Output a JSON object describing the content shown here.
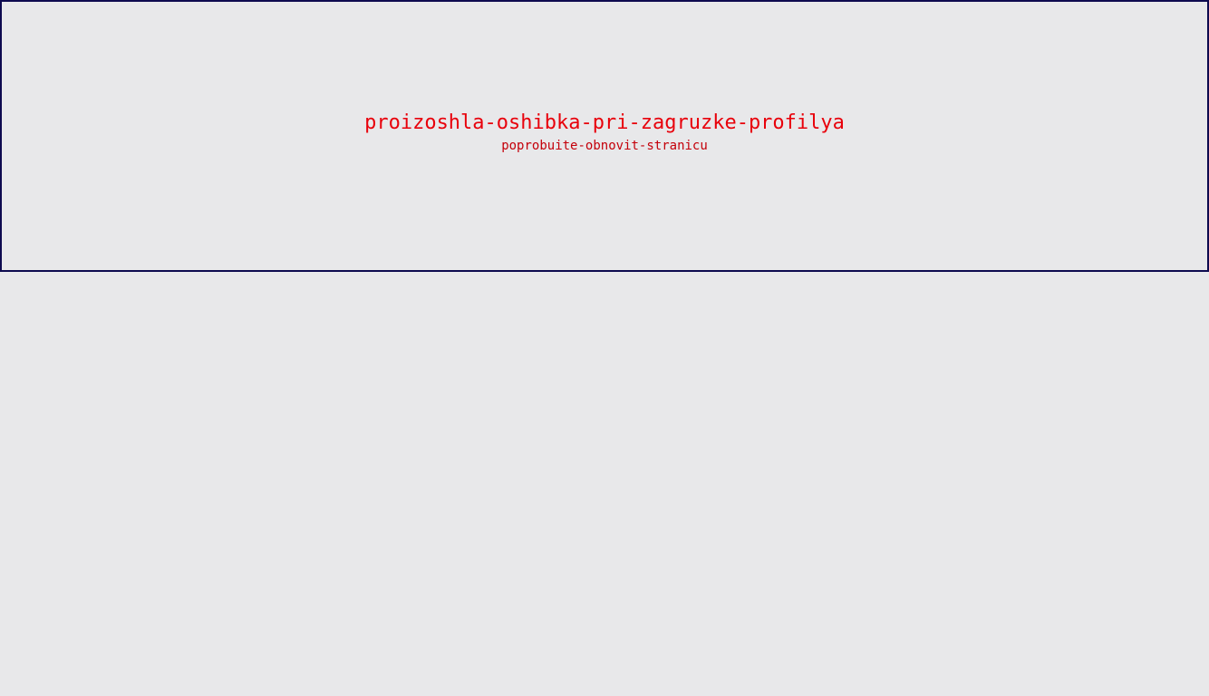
{
  "error": {
    "title": "proizoshla-oshibka-pri-zagruzke-profilya",
    "subtitle": "poprobuite-obnovit-stranicu"
  },
  "colors": {
    "background": "#e8e8ea",
    "panel_border": "#0d0a4f",
    "error_text": "#e8000b"
  }
}
